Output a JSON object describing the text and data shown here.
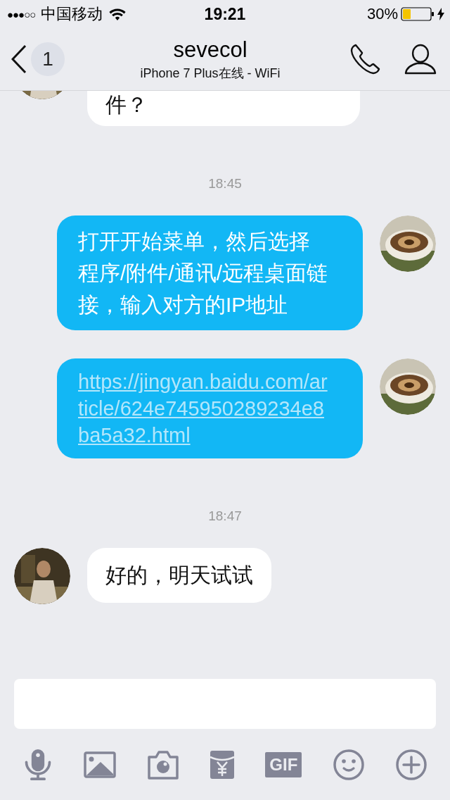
{
  "status_bar": {
    "signal": "●●●○○",
    "carrier": "中国移动",
    "time": "19:21",
    "battery": "30%"
  },
  "header": {
    "back_badge": "1",
    "title": "sevecol",
    "subtitle": "iPhone 7 Plus在线 - WiFi"
  },
  "messages": [
    {
      "kind": "message",
      "sent": false,
      "text": "件？",
      "link": false
    },
    {
      "kind": "time",
      "text": "18:45"
    },
    {
      "kind": "message",
      "sent": true,
      "text": "打开开始菜单，然后选择程序/附件/通讯/远程桌面链接，输入对方的IP地址",
      "link": false
    },
    {
      "kind": "message",
      "sent": true,
      "text": "https://jingyan.baidu.com/article/624e745950289234e8ba5a32.html",
      "link": true
    },
    {
      "kind": "time",
      "text": "18:47"
    },
    {
      "kind": "message",
      "sent": false,
      "text": "好的，明天试试",
      "link": false
    }
  ],
  "toolbar": {
    "gif_label": "GIF"
  }
}
